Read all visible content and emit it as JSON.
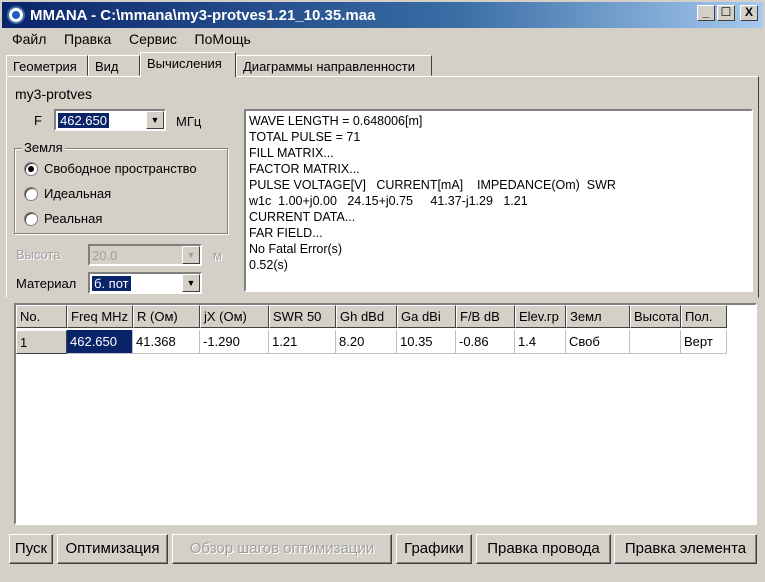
{
  "window": {
    "title": "MMANA - C:\\mmana\\my3-protves1.21_10.35.maa",
    "minimize": "_",
    "maximize": "☐",
    "close": "X"
  },
  "menu": [
    {
      "label": "Файл"
    },
    {
      "label": "Правка"
    },
    {
      "label": "Сервис"
    },
    {
      "label": "ПоМощь"
    }
  ],
  "tabs": [
    {
      "label": "Геометрия"
    },
    {
      "label": "Вид"
    },
    {
      "label": "Вычисления"
    },
    {
      "label": "Диаграммы направленности"
    }
  ],
  "calc": {
    "project_name": "my3-protves",
    "freq_label": "F",
    "freq_value": "462.650",
    "freq_unit": "МГц",
    "ground_group_title": "Земля",
    "ground_options": [
      "Свободное пространство",
      "Идеальная",
      "Реальная"
    ],
    "selected_ground": "Свободное пространство",
    "height_label": "Высота",
    "height_value": "20.0",
    "height_unit": "м",
    "material_label": "Материал",
    "material_value": "б. пот"
  },
  "output_lines": [
    "WAVE LENGTH = 0.648006[m]",
    "TOTAL PULSE = 71",
    "FILL MATRIX...",
    "FACTOR MATRIX...",
    "PULSE VOLTAGE[V]   CURRENT[mA]    IMPEDANCE(Om)  SWR",
    "w1c  1.00+j0.00   24.15+j0.75     41.37-j1.29   1.21",
    "CURRENT DATA...",
    "FAR FIELD...",
    "No Fatal Error(s)",
    "0.52(s)"
  ],
  "table": {
    "headers": [
      "No.",
      "Freq MHz",
      "R (Ом)",
      "jX (Ом)",
      "SWR 50",
      "Gh dBd",
      "Ga dBi",
      "F/B dB",
      "Elev.гр",
      "Земл",
      "Высота",
      "Пол."
    ],
    "rows": [
      [
        "1",
        "462.650",
        "41.368",
        "-1.290",
        "1.21",
        "8.20",
        "10.35",
        "-0.86",
        "1.4",
        "Своб",
        "",
        "Верт"
      ]
    ]
  },
  "buttons": [
    {
      "label": "Пуск",
      "enabled": true
    },
    {
      "label": "Оптимизация",
      "enabled": true
    },
    {
      "label": "Обзор шагов оптимизации",
      "enabled": false
    },
    {
      "label": "Графики",
      "enabled": true
    },
    {
      "label": "Правка провода",
      "enabled": true
    },
    {
      "label": "Правка элемента",
      "enabled": true
    }
  ]
}
